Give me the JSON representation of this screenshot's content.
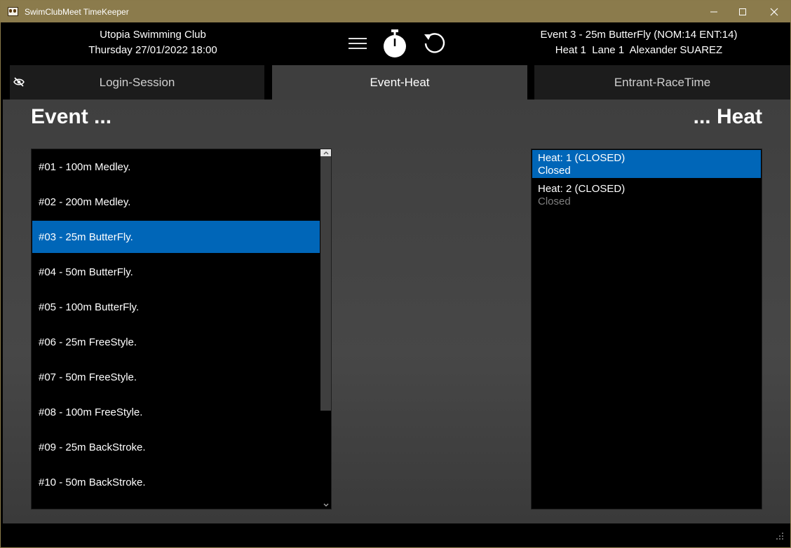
{
  "window": {
    "title": "SwimClubMeet TimeKeeper"
  },
  "header": {
    "club_name": "Utopia Swimming Club",
    "session_datetime": "Thursday 27/01/2022 18:00",
    "event_line": "Event 3 - 25m ButterFly (NOM:14 ENT:14)",
    "heat_line": "Heat 1  Lane 1  Alexander SUAREZ"
  },
  "tabs": [
    {
      "label": "Login-Session",
      "active": false
    },
    {
      "label": "Event-Heat",
      "active": true
    },
    {
      "label": "Entrant-RaceTime",
      "active": false
    }
  ],
  "main": {
    "event_heading": "Event ...",
    "heat_heading": "... Heat"
  },
  "events": [
    {
      "label": "#01 - 100m Medley.",
      "selected": false
    },
    {
      "label": "#02 - 200m Medley.",
      "selected": false
    },
    {
      "label": "#03 - 25m ButterFly.",
      "selected": true
    },
    {
      "label": "#04 - 50m ButterFly.",
      "selected": false
    },
    {
      "label": "#05 - 100m ButterFly.",
      "selected": false
    },
    {
      "label": "#06 - 25m FreeStyle.",
      "selected": false
    },
    {
      "label": "#07 - 50m FreeStyle.",
      "selected": false
    },
    {
      "label": "#08 - 100m FreeStyle.",
      "selected": false
    },
    {
      "label": "#09 - 25m BackStroke.",
      "selected": false
    },
    {
      "label": "#10 - 50m BackStroke.",
      "selected": false
    }
  ],
  "heats": [
    {
      "label": "Heat: 1 (CLOSED)",
      "status": "Closed",
      "selected": true
    },
    {
      "label": "Heat: 2 (CLOSED)",
      "status": "Closed",
      "selected": false
    }
  ],
  "colors": {
    "titlebar": "#8b7b4c",
    "selection": "#0066b8"
  },
  "icons": {
    "menu": "hamburger-icon",
    "timer": "stopwatch-icon",
    "refresh": "refresh-icon",
    "hide": "eye-slash-icon"
  }
}
